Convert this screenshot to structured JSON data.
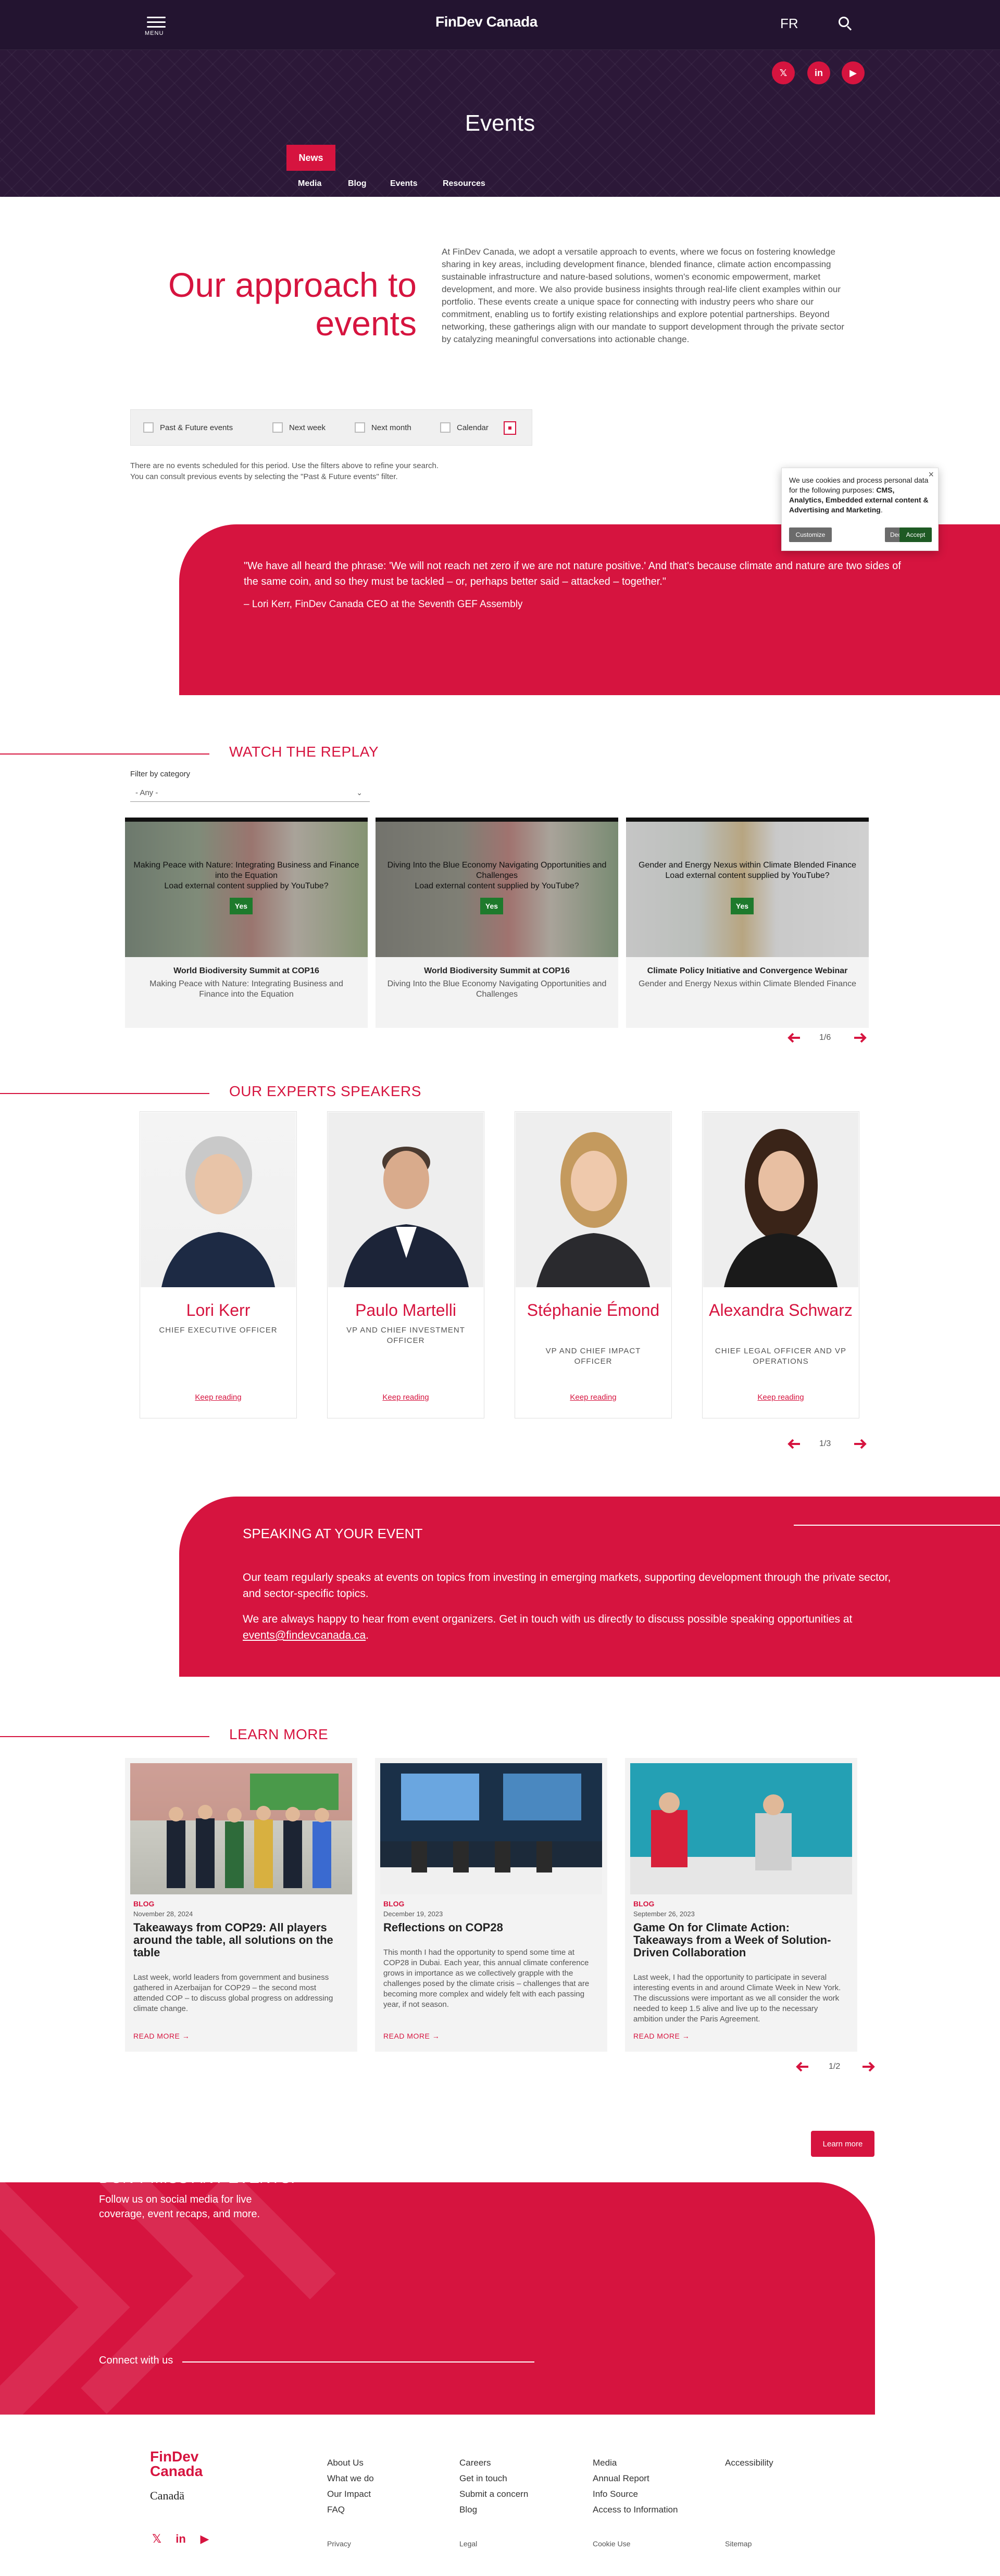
{
  "header": {
    "menu_label": "MENU",
    "logo": "FinDev Canada",
    "lang": "FR"
  },
  "hero": {
    "title": "Events",
    "active_tab": "News",
    "subnav": [
      "Media",
      "Blog",
      "Events",
      "Resources"
    ]
  },
  "social_icons": [
    "x-icon",
    "linkedin-icon",
    "youtube-icon"
  ],
  "approach": {
    "title": "Our approach to events",
    "text": "At FinDev Canada, we adopt a versatile approach to events, where we focus on fostering knowledge sharing in key areas, including development finance, blended finance, climate action encompassing sustainable infrastructure and nature-based solutions, women's economic empowerment, market development, and more. We also provide business insights through real-life client examples within our portfolio. These events create a unique space for connecting with industry peers who share our commitment, enabling us to fortify existing relationships and explore potential partnerships. Beyond networking, these gatherings align with our mandate to support development through the private sector by catalyzing meaningful conversations into actionable change."
  },
  "filters": {
    "options": [
      "Past & Future events",
      "Next week",
      "Next month",
      "Calendar"
    ],
    "no_events_1": "There are no events scheduled for this period. Use the filters above to refine your search.",
    "no_events_2": "You can consult previous events by selecting the \"Past & Future events\" filter."
  },
  "cookie": {
    "text_1": "We use cookies and process personal data for the following purposes: ",
    "text_bold": "CMS, Analytics, Embedded external content & Advertising and Marketing",
    "text_2": ".",
    "close": "×",
    "customize": "Customize",
    "decline": "Decline",
    "accept": "Accept"
  },
  "quote": {
    "text": "\"We have all heard the phrase: 'We will not reach net zero if we are not nature positive.' And that's because climate and nature are two sides of the same coin, and so they must be tackled – or, perhaps better said – attacked – together.\"",
    "author": "– Lori Kerr, FinDev Canada CEO at the Seventh GEF Assembly"
  },
  "replay": {
    "heading": "WATCH THE REPLAY",
    "filter_label": "Filter by category",
    "filter_value": "- Any -",
    "pager": "1/6",
    "videos": [
      {
        "overlay_title": "Making Peace with Nature: Integrating Business and Finance into the Equation",
        "consent": "Load external content supplied by YouTube?",
        "yes": "Yes",
        "event": "World Biodiversity Summit at COP16",
        "title": "Making Peace with Nature: Integrating Business and Finance into the Equation"
      },
      {
        "overlay_title": "Diving Into the Blue Economy Navigating Opportunities and Challenges",
        "consent": "Load external content supplied by YouTube?",
        "yes": "Yes",
        "event": "World Biodiversity Summit at COP16",
        "title": "Diving Into the Blue Economy Navigating Opportunities and Challenges"
      },
      {
        "overlay_title": "Gender and Energy Nexus within Climate Blended Finance",
        "consent": "Load external content supplied by YouTube?",
        "yes": "Yes",
        "event": "Climate Policy Initiative and Convergence Webinar",
        "title": "Gender and Energy Nexus within Climate Blended Finance"
      }
    ]
  },
  "experts": {
    "heading": "OUR EXPERTS SPEAKERS",
    "pager": "1/3",
    "people": [
      {
        "name": "Lori Kerr",
        "role": "CHIEF EXECUTIVE OFFICER",
        "link": "Keep reading"
      },
      {
        "name": "Paulo Martelli",
        "role": "VP AND CHIEF INVESTMENT OFFICER",
        "link": "Keep reading"
      },
      {
        "name": "Stéphanie Émond",
        "role": "VP AND CHIEF IMPACT OFFICER",
        "link": "Keep reading"
      },
      {
        "name": "Alexandra Schwarz",
        "role": "CHIEF LEGAL OFFICER AND VP OPERATIONS",
        "link": "Keep reading"
      }
    ]
  },
  "speaking": {
    "heading": "SPEAKING AT YOUR EVENT",
    "p1": "Our team regularly speaks at events on topics from investing in emerging markets, supporting development through the private sector, and sector-specific topics.",
    "p2": "We are always happy to hear from event organizers. Get in touch with us directly to discuss possible speaking opportunities at ",
    "email": "events@findevcanada.ca",
    "p2_end": "."
  },
  "learn": {
    "heading": "LEARN MORE",
    "pager": "1/2",
    "button": "Learn more",
    "posts": [
      {
        "tag": "BLOG",
        "date": "November 28, 2024",
        "title": "Takeaways from COP29: All players around the table, all solutions on the table",
        "text": "Last week, world leaders from government and business gathered in Azerbaijan for COP29 – the second most attended COP – to discuss global progress on addressing climate change.",
        "read": "READ MORE"
      },
      {
        "tag": "BLOG",
        "date": "December 19, 2023",
        "title": "Reflections on COP28",
        "text": "This month I had the opportunity to spend some time at COP28 in Dubai. Each year, this annual climate conference grows in importance as we collectively grapple with the challenges posed by the climate crisis – challenges that are becoming more complex and widely felt with each passing year, if not season.",
        "read": "READ MORE"
      },
      {
        "tag": "BLOG",
        "date": "September 26, 2023",
        "title": "Game On for Climate Action: Takeaways from a Week of Solution-Driven Collaboration",
        "text": "Last week, I had the opportunity to participate in several interesting events in and around Climate Week in New York. The discussions were important as we all consider the work needed to keep 1.5 alive and live up to the necessary ambition under the Paris Agreement.",
        "read": "READ MORE"
      }
    ]
  },
  "dont_miss": {
    "heading": "DON'T MISS ANY EVENTS!",
    "sub": "Follow us on social media for live coverage, event recaps, and more.",
    "connect": "Connect with us"
  },
  "footer": {
    "logo_1": "FinDev",
    "logo_2": "Canada",
    "canada": "Canadä",
    "col1": [
      "About Us",
      "What we do",
      "Our Impact",
      "FAQ"
    ],
    "col2": [
      "Careers",
      "Get in touch",
      "Submit a concern",
      "Blog"
    ],
    "col3": [
      "Media",
      "Annual Report",
      "Info Source",
      "Access to Information"
    ],
    "col4": [
      "Accessibility"
    ],
    "bottom": [
      "Privacy",
      "Legal",
      "Cookie Use",
      "Sitemap"
    ]
  },
  "colors": {
    "accent": "#d6143f",
    "hero_bg": "#2c1838"
  }
}
